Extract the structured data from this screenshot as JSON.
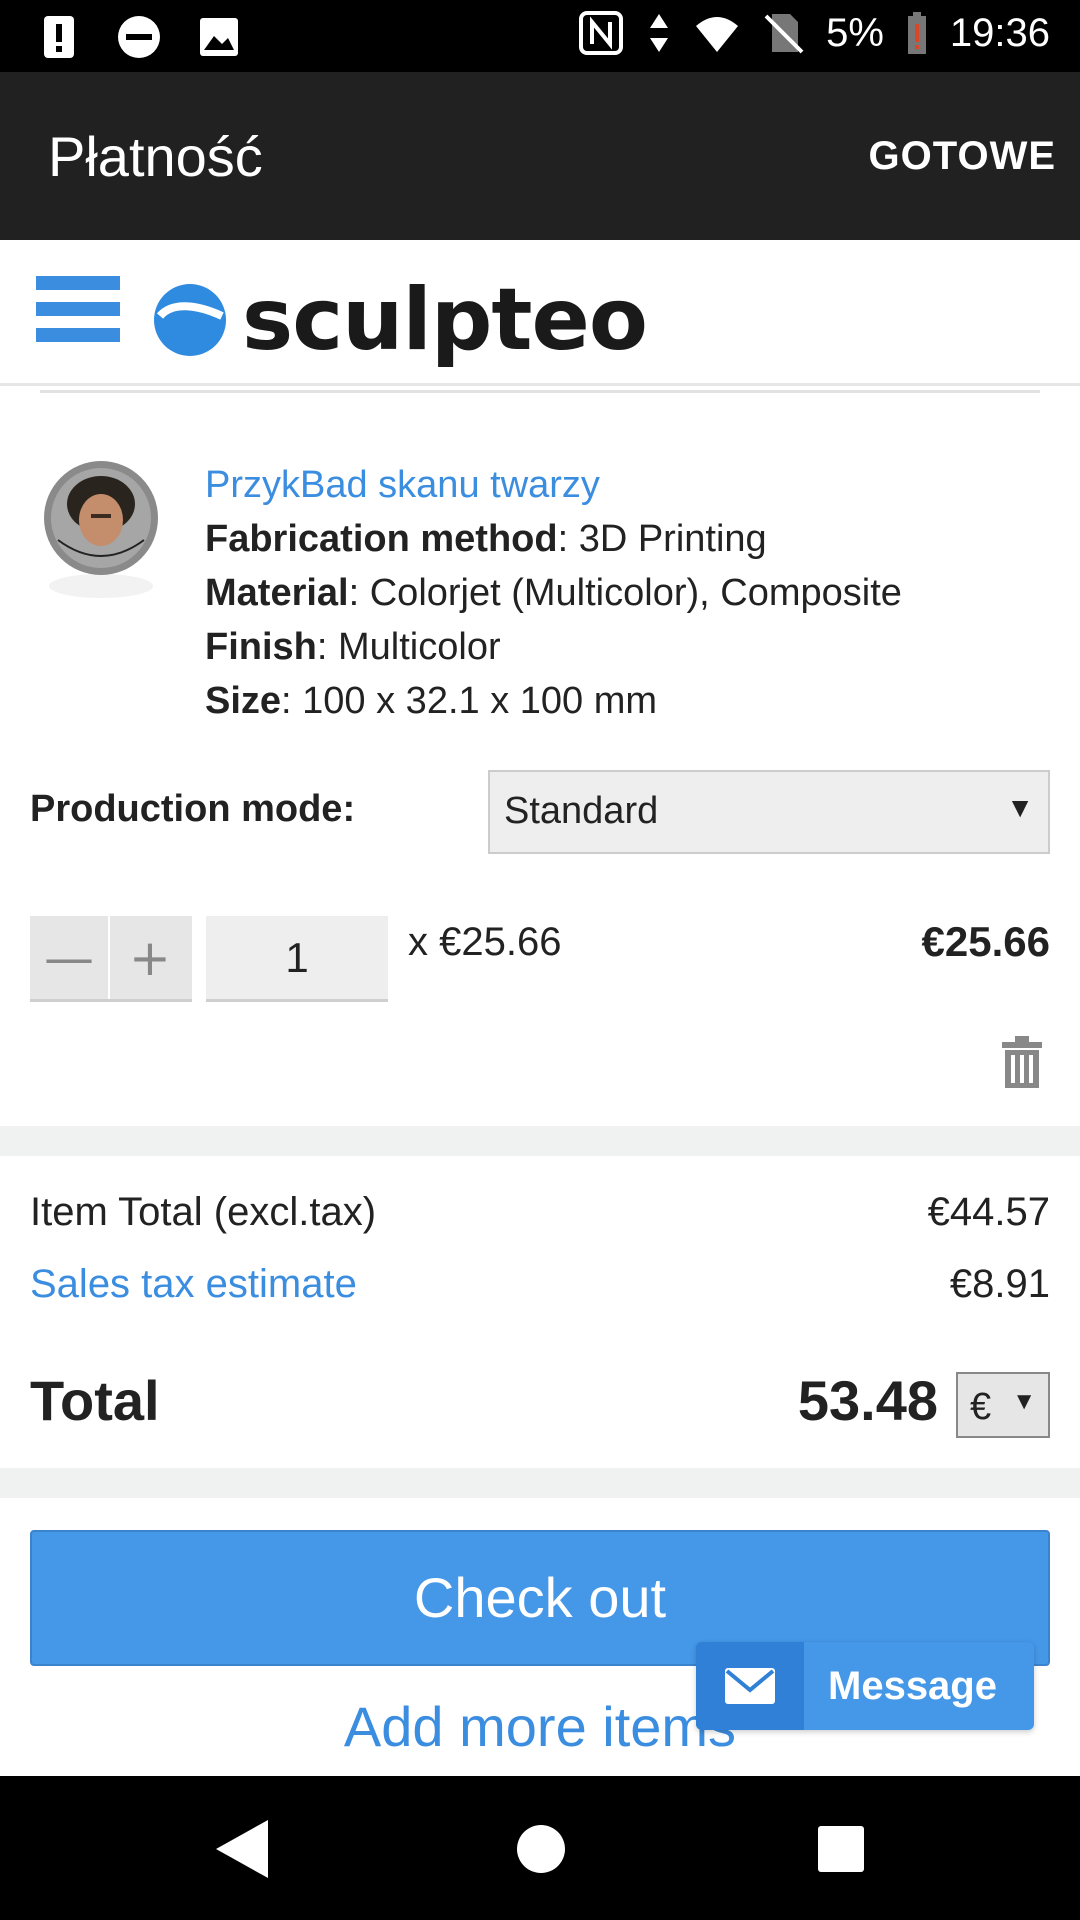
{
  "status_bar": {
    "battery": "5%",
    "time": "19:36",
    "icons": [
      "alert-icon",
      "dnd-icon",
      "image-icon",
      "nfc-icon",
      "data-arrows-icon",
      "wifi-icon",
      "no-sim-icon",
      "battery-low-icon"
    ]
  },
  "action_bar": {
    "title": "Płatność",
    "done_label": "GOTOWE"
  },
  "site": {
    "logo_text": "sculpteo",
    "brand_color": "#3b8de0"
  },
  "product": {
    "name": "PrzykBad skanu twarzy",
    "thumb_caption": "PrzykBad skanu twarzy",
    "fabrication_label": "Fabrication method",
    "fabrication_value": ": 3D Printing",
    "material_label": "Material",
    "material_value": ": Colorjet (Multicolor), Composite",
    "finish_label": "Finish",
    "finish_value": ": Multicolor",
    "size_label": "Size",
    "size_value": ": 100 x 32.1 x 100 mm"
  },
  "production_mode": {
    "label": "Production mode:",
    "selected": "Standard"
  },
  "quantity": {
    "minus": "—",
    "plus": "+",
    "value": "1",
    "unit_price": "x €25.66",
    "line_total": "€25.66"
  },
  "summary": {
    "item_total_label": "Item Total (excl.tax)",
    "item_total_value": "€44.57",
    "tax_label": "Sales tax estimate",
    "tax_value": "€8.91",
    "total_label": "Total",
    "total_value": "53.48",
    "currency": "€"
  },
  "actions": {
    "checkout_label": "Check out",
    "add_more_label": "Add more items",
    "message_label": "Message"
  }
}
